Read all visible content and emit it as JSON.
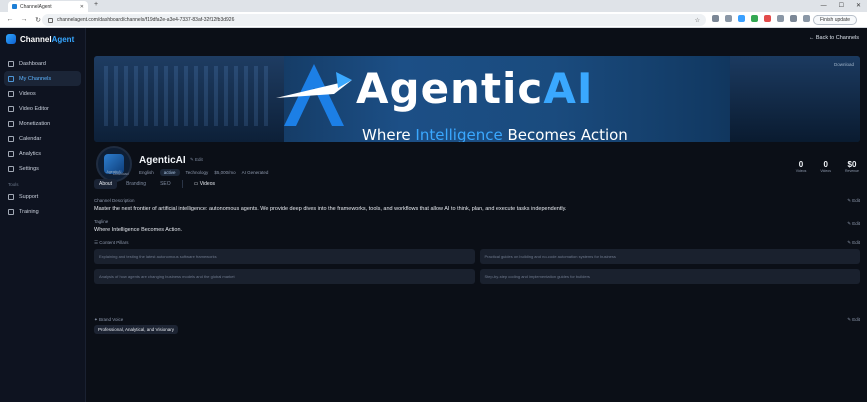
{
  "browser": {
    "tab_title": "ChannelAgent",
    "url": "channelagent.com/dashboard/channels/f19dfa2e-a3e4-7337-83af-32f12fb3d926",
    "finish_update": "Finish update"
  },
  "brand": {
    "name_prefix": "Channel",
    "name_suffix": "Agent"
  },
  "sidebar": {
    "items": [
      {
        "label": "Dashboard",
        "icon": "grid-icon"
      },
      {
        "label": "My Channels",
        "icon": "channels-icon",
        "active": true
      },
      {
        "label": "Videos",
        "icon": "video-icon"
      },
      {
        "label": "Video Editor",
        "icon": "scissors-icon"
      },
      {
        "label": "Monetization",
        "icon": "dollar-icon"
      },
      {
        "label": "Calendar",
        "icon": "calendar-icon"
      },
      {
        "label": "Analytics",
        "icon": "chart-icon"
      },
      {
        "label": "Settings",
        "icon": "gear-icon"
      }
    ],
    "section_label": "Tools",
    "tools": [
      {
        "label": "Support",
        "icon": "help-icon"
      },
      {
        "label": "Training",
        "icon": "book-icon"
      }
    ]
  },
  "header": {
    "back_label": "Back to Channels"
  },
  "banner": {
    "download": "Download",
    "title_white": "Agentic",
    "title_blue": "AI",
    "tagline_a": "Where ",
    "tagline_b": "Intelligence",
    "tagline_c": " Becomes Action"
  },
  "channel": {
    "name": "AgenticAI",
    "edit": "Edit",
    "avatar_label": "AgenticAI",
    "avatar_download": "Download",
    "meta": [
      "English",
      "active",
      "Technology",
      "$5,000/mo",
      "AI Generated"
    ],
    "stats": [
      {
        "value": "0",
        "label": "Videos"
      },
      {
        "value": "0",
        "label": "Videos"
      },
      {
        "value": "$0",
        "label": "Revenue"
      }
    ]
  },
  "tabs": [
    "About",
    "Branding",
    "SEO",
    "Videos"
  ],
  "about": {
    "description_label": "Channel Description",
    "description": "Master the next frontier of artificial intelligence: autonomous agents. We provide deep dives into the frameworks, tools, and workflows that allow AI to think, plan, and execute tasks independently.",
    "tagline_label": "Tagline",
    "tagline": "Where Intelligence Becomes Action.",
    "pillars_label": "Content Pillars",
    "pillars": [
      "Explaining and testing the latest autonomous software frameworks",
      "Practical guides on building and no-code automation systems for business",
      "Analysis of how agents are changing business models and the global market",
      "Step-by-step coding and implementation guides for builders"
    ],
    "voice_label": "Brand Voice",
    "voice": "Professional, Analytical, and Visionary",
    "edit": "Edit"
  }
}
